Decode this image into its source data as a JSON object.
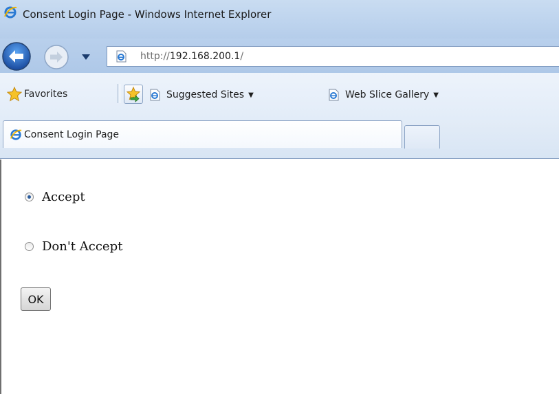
{
  "window": {
    "title": "Consent Login Page - Windows Internet Explorer"
  },
  "navigation": {
    "url_prefix": "http://",
    "url_host": "192.168.200.1",
    "url_suffix": "/"
  },
  "favorites_bar": {
    "favorites_label": "Favorites",
    "links": [
      {
        "label": "Suggested Sites",
        "icon": "ie-page-icon"
      },
      {
        "label": "Web Slice Gallery",
        "icon": "ie-page-icon"
      }
    ]
  },
  "tabs": [
    {
      "label": "Consent Login Page",
      "active": true
    }
  ],
  "form": {
    "options": [
      {
        "label": "Accept",
        "checked": true
      },
      {
        "label": "Don't Accept",
        "checked": false
      }
    ],
    "submit_label": "OK"
  },
  "colors": {
    "chrome_blue": "#bed4ee",
    "radio_checked": "#2b5c9c"
  }
}
